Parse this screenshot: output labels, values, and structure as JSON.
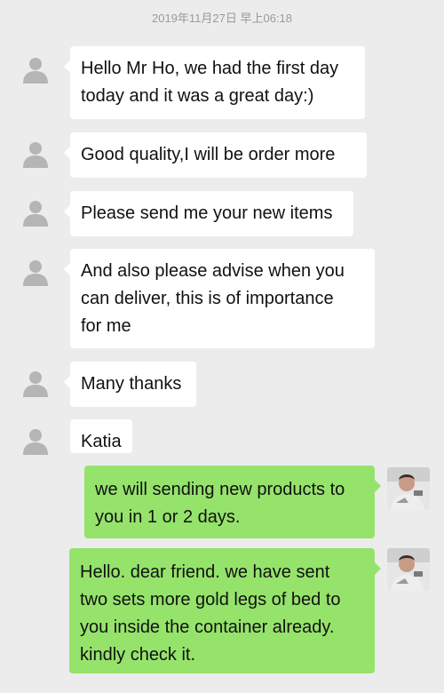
{
  "timestamp": "2019年11月27日 早上06:18",
  "colors": {
    "background": "#ececec",
    "incoming_bubble": "#ffffff",
    "outgoing_bubble": "#95e36b",
    "default_avatar": "#b5b5b5"
  },
  "incoming": [
    {
      "lines": [
        "Hello Mr Ho, we had the first day",
        "today and it was a great day:)"
      ]
    },
    {
      "lines": [
        "Good quality,I will be order more"
      ]
    },
    {
      "lines": [
        "Please send me your new items"
      ]
    },
    {
      "lines": [
        "And also please advise when you",
        "can deliver, this is of importance",
        "for me"
      ]
    },
    {
      "lines": [
        "Many thanks"
      ]
    },
    {
      "lines": [
        "Katia"
      ]
    }
  ],
  "outgoing": [
    {
      "lines": [
        "we will sending new products to",
        "you in 1 or 2 days."
      ]
    },
    {
      "lines": [
        "Hello.  dear friend.  we have sent",
        "two sets more gold legs of bed to",
        "you inside  the container already.",
        "kindly check it."
      ]
    }
  ],
  "icons": {
    "incoming_avatar": "default-user-avatar-icon",
    "outgoing_avatar": "user-photo-avatar"
  }
}
